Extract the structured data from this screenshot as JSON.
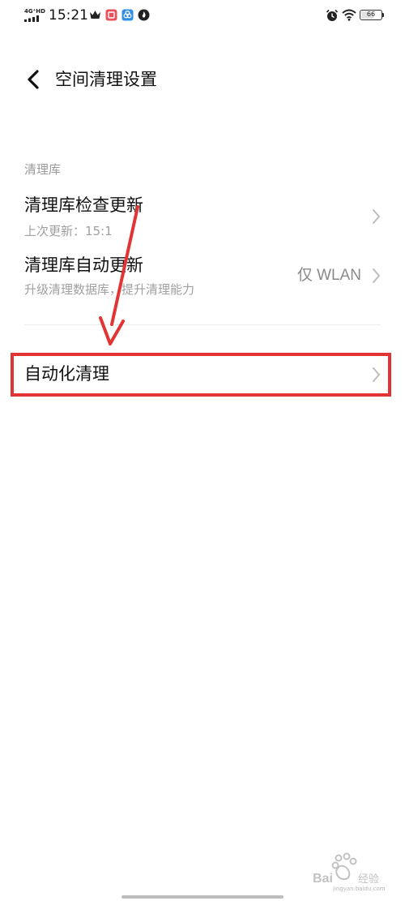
{
  "status_bar": {
    "network": "4G⁺HD",
    "time": "15:21",
    "battery": "66",
    "battery_level": 0.66
  },
  "header": {
    "title": "空间清理设置"
  },
  "section": {
    "header": "清理库",
    "rows": [
      {
        "title": "清理库检查更新",
        "subtitle": "上次更新：15:1"
      },
      {
        "title": "清理库自动更新",
        "subtitle": "升级清理数据库，提升清理能力",
        "value": "仅 WLAN"
      },
      {
        "title": "自动化清理"
      }
    ]
  },
  "annotation": {
    "color": "#e23434"
  },
  "watermark": {
    "subtext": "jingyan.baidu.com"
  }
}
